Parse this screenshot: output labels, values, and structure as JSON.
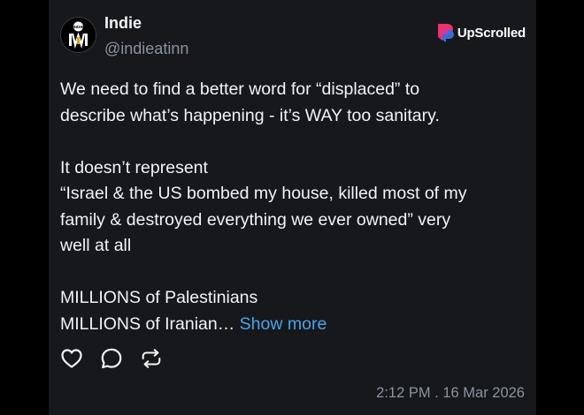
{
  "post": {
    "author_name": "Indie",
    "author_handle": "@indieatinn",
    "avatar_label": "INDIE",
    "text_lines": [
      "We need to find a better word for “displaced” to",
      "describe what’s happening - it’s WAY too sanitary.",
      "It doesn’t represent",
      "“Israel & the US bombed my house, killed most of my",
      "family & destroyed everything we ever owned” very",
      "well at all",
      "MILLIONS of Palestinians",
      "MILLIONS of Iranian…"
    ],
    "show_more": "Show more",
    "timestamp": "2:12 PM . 16 Mar 2026"
  },
  "brand": {
    "name": "UpScrolled",
    "icon": "upscrolled-logo-icon",
    "colors": {
      "pink": "#e8336b",
      "blue": "#3b6fe0"
    }
  },
  "actions": [
    {
      "name": "like",
      "icon": "heart-icon"
    },
    {
      "name": "comment",
      "icon": "comment-icon"
    },
    {
      "name": "repost",
      "icon": "repost-icon"
    }
  ],
  "colors": {
    "card_background": "#16181c",
    "text": "#f2f3f4",
    "muted": "#8b949e",
    "link": "#4aa3e8"
  }
}
